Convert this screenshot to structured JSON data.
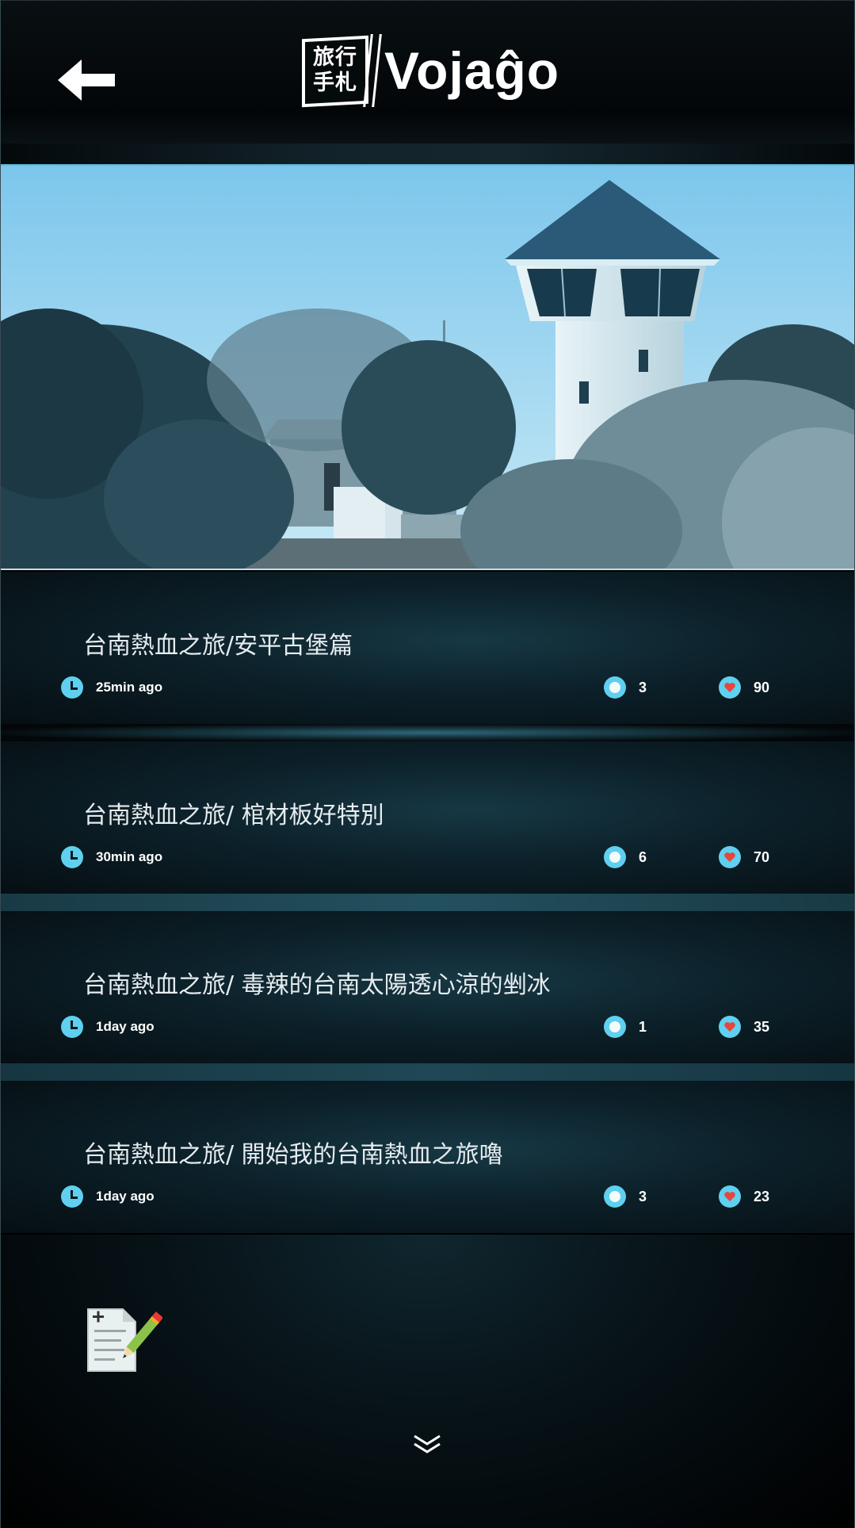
{
  "header": {
    "back_icon": "back-arrow-icon",
    "logo_chars": "旅行\n手札",
    "logo_icon": "travel-notebook-logo",
    "brand_name": "Vojaĝo"
  },
  "hero": {
    "image": "blue-tinted photo of lighthouse tower and trees"
  },
  "posts": [
    {
      "title": "台南熱血之旅/安平古堡篇",
      "time": "25min ago",
      "comments": "3",
      "likes": "90"
    },
    {
      "title": "台南熱血之旅/ 棺材板好特別",
      "time": "30min ago",
      "comments": "6",
      "likes": "70"
    },
    {
      "title": "台南熱血之旅/ 毒辣的台南太陽透心涼的剉冰",
      "time": "1day ago",
      "comments": "1",
      "likes": "35"
    },
    {
      "title": "台南熱血之旅/ 開始我的台南熱血之旅嚕",
      "time": "1day ago",
      "comments": "3",
      "likes": "23"
    }
  ],
  "icons": {
    "time": "clock-icon",
    "comments": "comment-bubble-icon",
    "likes": "heart-icon",
    "compose": "compose-note-icon",
    "more": "double-chevron-down-icon"
  },
  "colors": {
    "accent": "#5fd0ef",
    "heart": "#e8453c",
    "background": "#000000"
  }
}
